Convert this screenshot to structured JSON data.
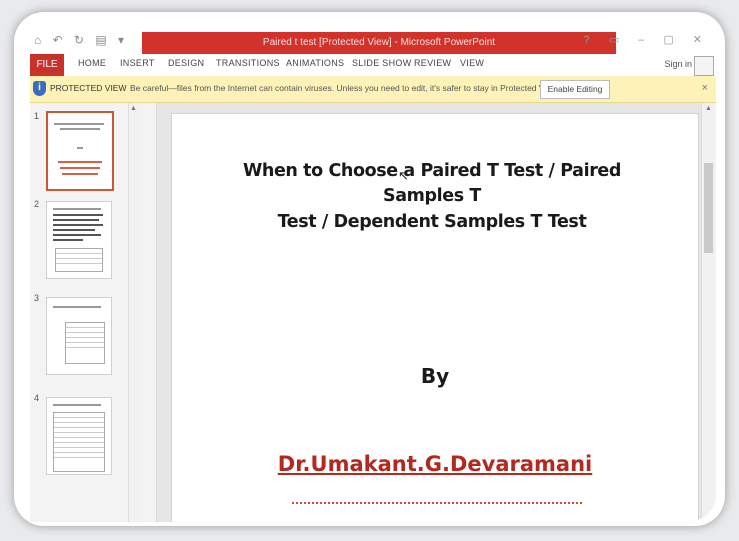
{
  "window": {
    "title": "Paired t test [Protected View] - Microsoft PowerPoint",
    "quick_access": "⌂ ↶ ↻ ▤ ▾",
    "controls": "? ▭ – ▢ ✕"
  },
  "ribbon": {
    "file_tab": "FILE",
    "tabs": [
      "HOME",
      "INSERT",
      "DESIGN",
      "TRANSITIONS",
      "ANIMATIONS",
      "SLIDE SHOW",
      "REVIEW",
      "VIEW"
    ],
    "sign_in": "Sign in"
  },
  "protected_view": {
    "label": "PROTECTED VIEW",
    "message": "Be careful—files from the Internet can contain viruses. Unless you need to edit, it's safer to stay in Protected View.",
    "button": "Enable Editing",
    "close": "×",
    "icon": "shield-icon",
    "color": "#fdf3b8"
  },
  "thumbnails": {
    "numbers": [
      "1",
      "2",
      "3",
      "4"
    ],
    "selected": "1"
  },
  "slide": {
    "title_line1": "When to Choose a Paired T Test / Paired Samples T",
    "title_line2": "Test / Dependent Samples T Test",
    "by": "By",
    "author": "Dr.Umakant.G.Devaramani",
    "accent_color": "#b4291f"
  }
}
